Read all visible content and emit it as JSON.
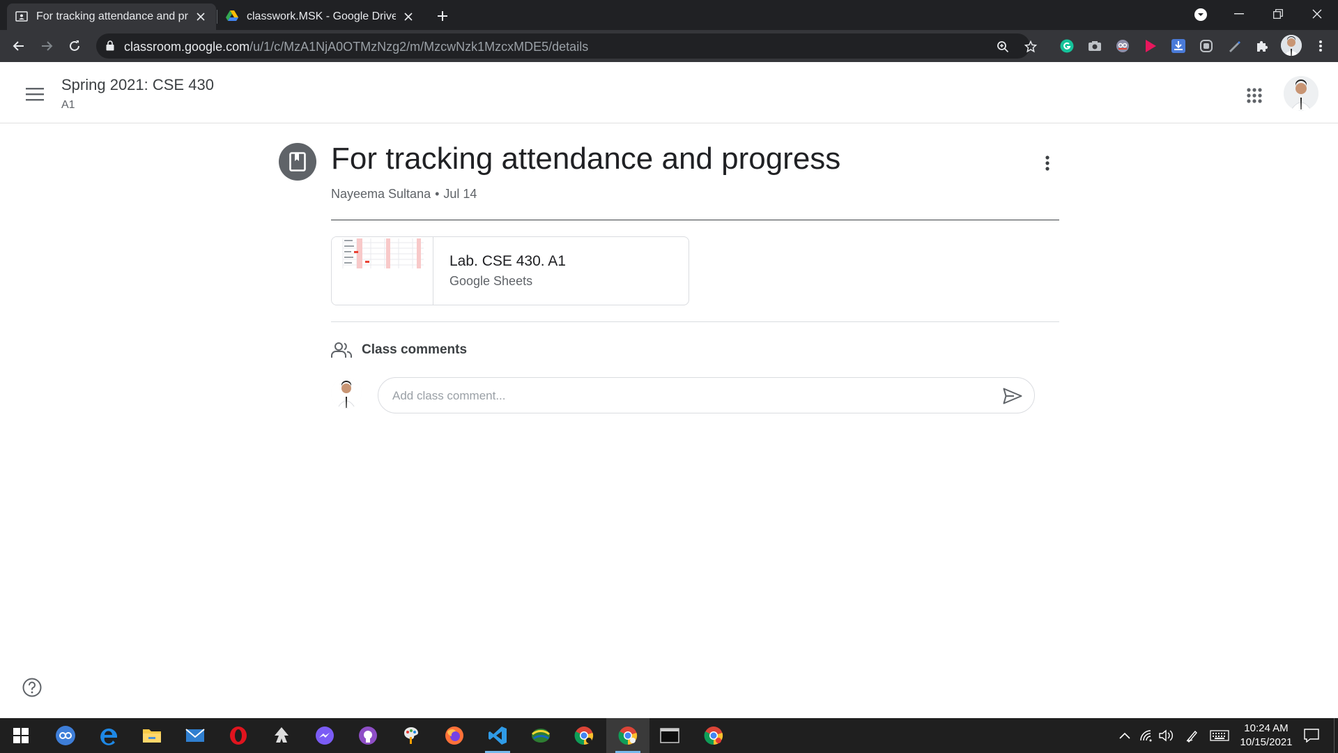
{
  "browser": {
    "tabs": [
      {
        "title": "For tracking attendance and progress",
        "favicon": "classroom-icon",
        "active": true
      },
      {
        "title": "classwork.MSK - Google Drive",
        "favicon": "google-drive-icon",
        "active": false
      }
    ],
    "url_host": "classroom.google.com",
    "url_path": "/u/1/c/MzA1NjA0OTMzNzg2/m/MzcwNzk1MzcxMDE5/details",
    "extensions": [
      "grammarly-icon",
      "camera-icon",
      "extension-icon",
      "play-icon",
      "download-icon",
      "extension-icon",
      "pen-icon",
      "puzzle-icon"
    ]
  },
  "header": {
    "course_title": "Spring 2021: CSE 430",
    "section": "A1"
  },
  "post": {
    "title": "For tracking attendance and progress",
    "author": "Nayeema Sultana",
    "separator": "•",
    "date": "Jul 14",
    "attachment": {
      "title": "Lab. CSE 430. A1",
      "type": "Google Sheets"
    }
  },
  "comments": {
    "heading": "Class comments",
    "placeholder": "Add class comment..."
  },
  "taskbar": {
    "apps": [
      "start-icon",
      "qbittorrent-icon",
      "edge-icon",
      "file-explorer-icon",
      "mail-icon",
      "opera-icon",
      "inkscape-icon",
      "messenger-icon",
      "github-desktop-icon",
      "paint-icon",
      "firefox-icon",
      "vscode-icon",
      "globe-icon",
      "chrome-icon",
      "chrome-icon",
      "terminal-icon",
      "chrome-icon"
    ],
    "time": "10:24 AM",
    "date": "10/15/2021"
  },
  "colors": {
    "chrome_dark": "#202124",
    "chrome_toolbar": "#35363a",
    "text_primary": "#202124",
    "text_secondary": "#5f6368",
    "divider": "#dadce0",
    "taskbar": "#1f1f1f",
    "vscode_blue": "#2f9be7"
  }
}
